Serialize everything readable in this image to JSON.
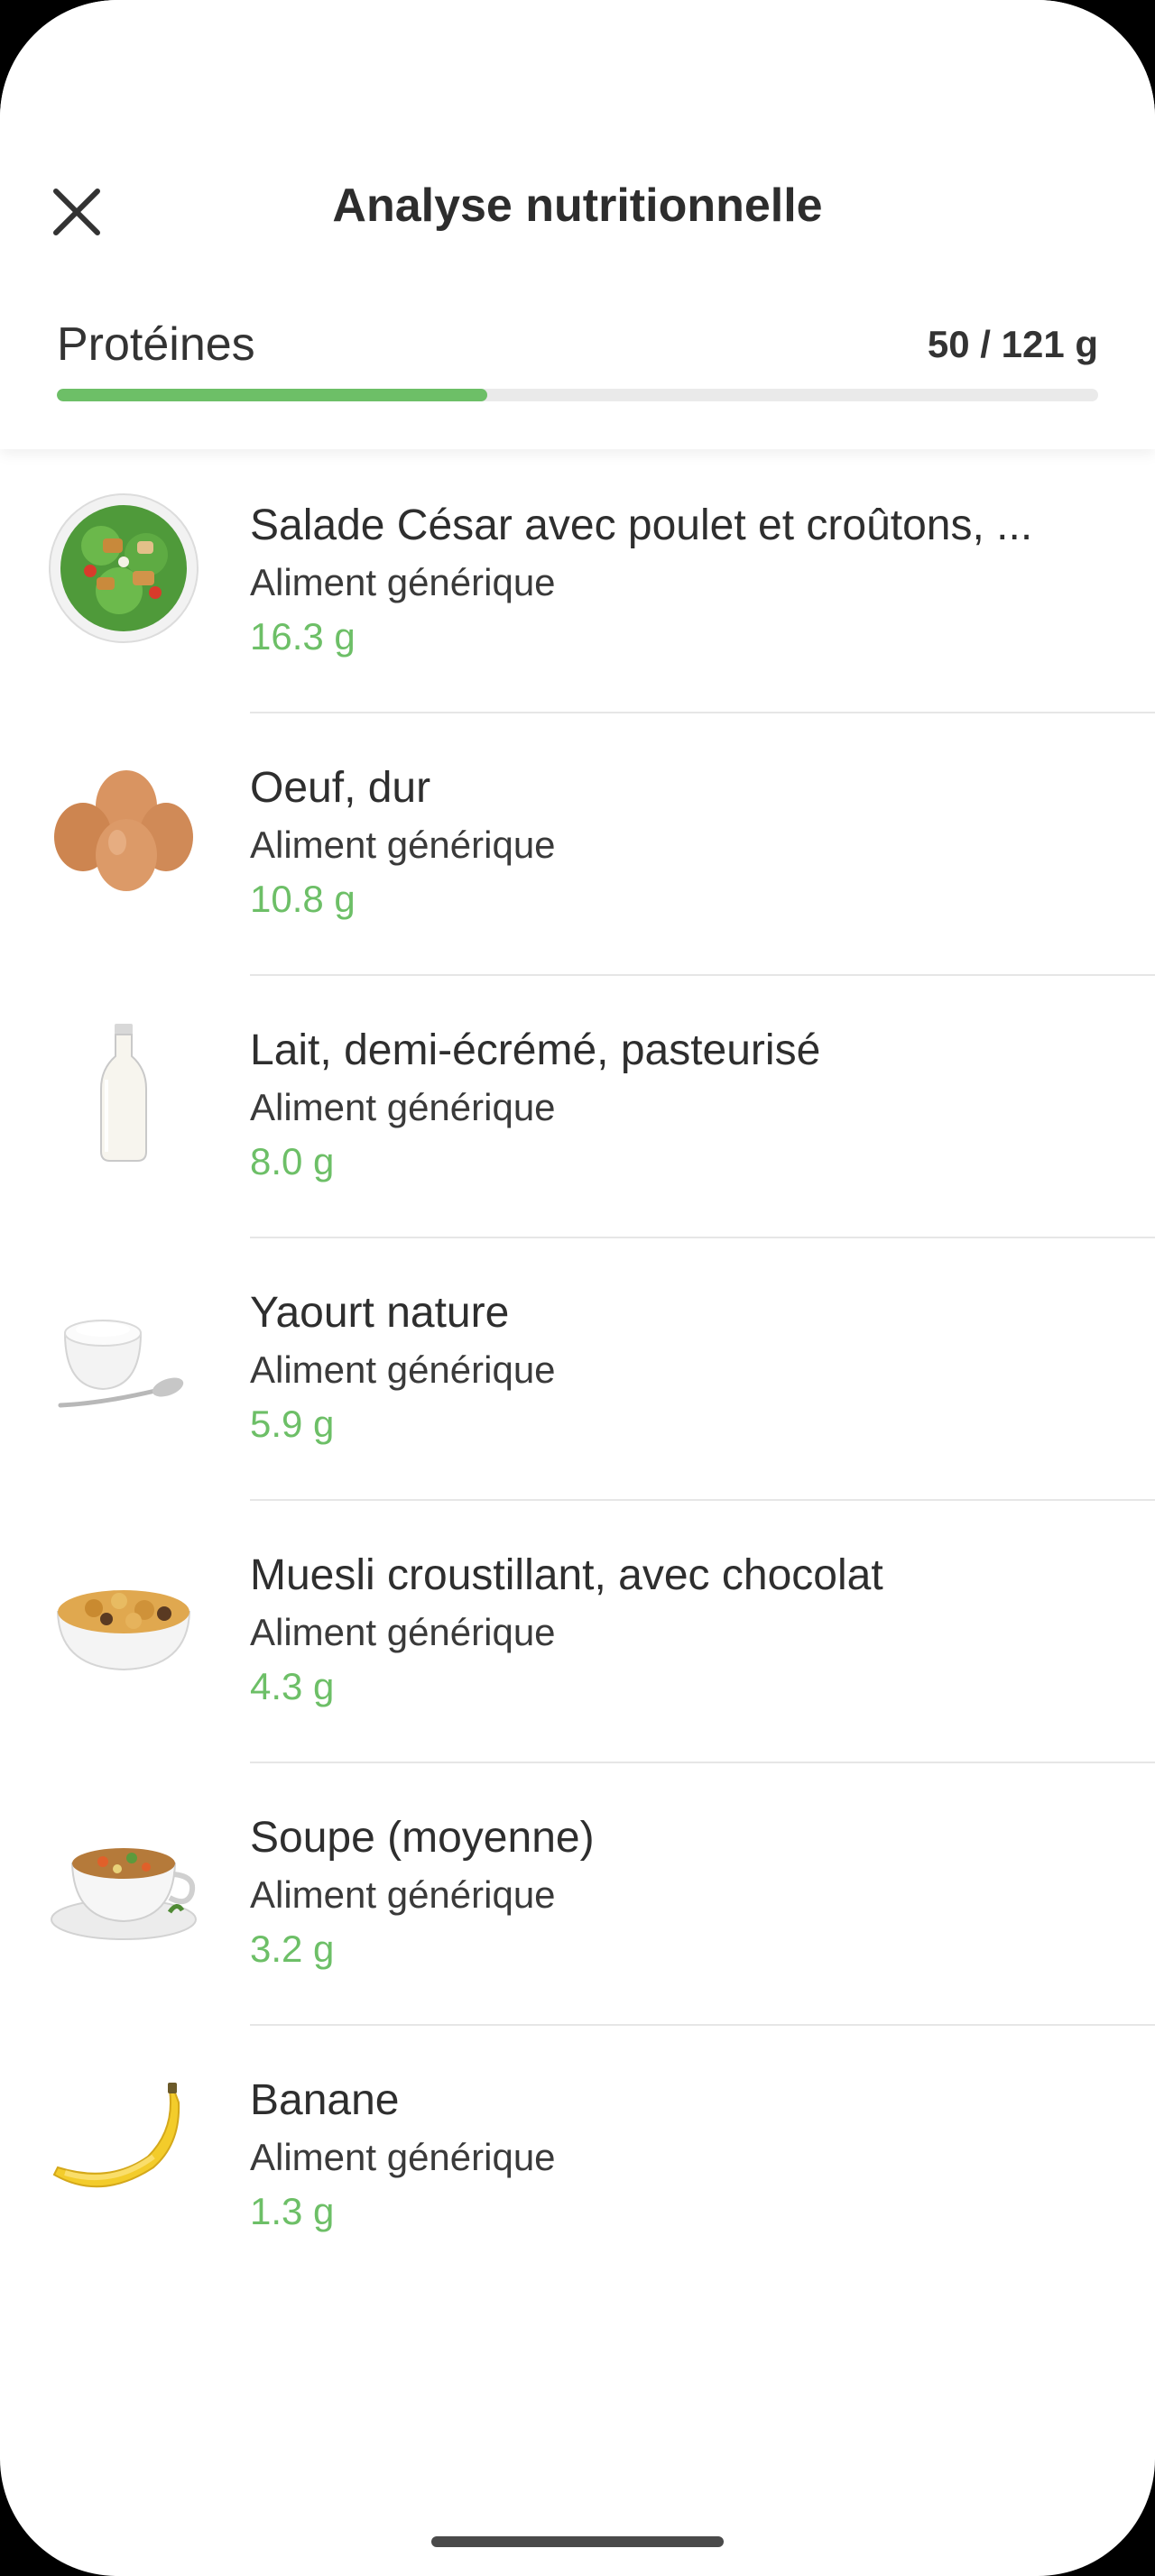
{
  "header": {
    "title": "Analyse nutritionnelle",
    "close_icon": "close-icon"
  },
  "nutrient": {
    "label": "Protéines",
    "value_text": "50 / 121 g",
    "current": 50,
    "goal": 121,
    "progress_fraction": 0.413,
    "progress_color": "#6dbf67"
  },
  "foods": [
    {
      "name": "Salade César avec poulet et croûtons, ...",
      "subtitle": "Aliment générique",
      "amount": "16.3 g",
      "icon": "caesar-salad-image"
    },
    {
      "name": "Oeuf, dur",
      "subtitle": "Aliment générique",
      "amount": "10.8 g",
      "icon": "eggs-image"
    },
    {
      "name": "Lait, demi-écrémé, pasteurisé",
      "subtitle": "Aliment générique",
      "amount": "8.0 g",
      "icon": "milk-bottle-image"
    },
    {
      "name": "Yaourt nature",
      "subtitle": "Aliment générique",
      "amount": "5.9 g",
      "icon": "yogurt-image"
    },
    {
      "name": "Muesli croustillant, avec chocolat",
      "subtitle": "Aliment générique",
      "amount": "4.3 g",
      "icon": "muesli-bowl-image"
    },
    {
      "name": "Soupe (moyenne)",
      "subtitle": "Aliment générique",
      "amount": "3.2 g",
      "icon": "soup-image"
    },
    {
      "name": "Banane",
      "subtitle": "Aliment générique",
      "amount": "1.3 g",
      "icon": "banana-image"
    }
  ],
  "colors": {
    "accent": "#6dbf67",
    "text": "#2d2d2d",
    "track": "#eaeaea"
  }
}
